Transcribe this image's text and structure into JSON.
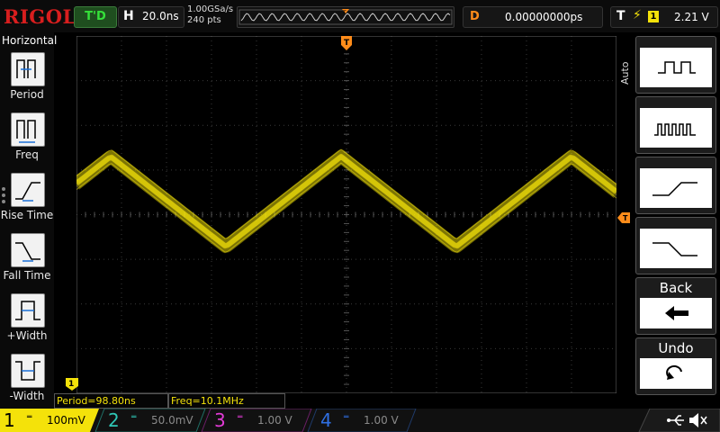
{
  "header": {
    "brand": "RIGOL",
    "run_state": "T'D",
    "horizontal": {
      "key": "H",
      "value": "20.0ns"
    },
    "sample_rate": "1.00GSa/s",
    "points": "240 pts",
    "delay": {
      "key": "D",
      "value": "0.00000000ps"
    },
    "trigger": {
      "key": "T",
      "source": "1",
      "level": "2.21 V"
    }
  },
  "left_menu": {
    "title": "Horizontal",
    "items": [
      {
        "label": "Period"
      },
      {
        "label": "Freq"
      },
      {
        "label": "Rise Time"
      },
      {
        "label": "Fall Time"
      },
      {
        "label": "+Width"
      },
      {
        "label": "-Width"
      }
    ]
  },
  "right_menu": {
    "mode_label": "Auto",
    "back_label": "Back",
    "undo_label": "Undo"
  },
  "measurements": [
    {
      "text": "Period=98.80ns"
    },
    {
      "text": "Freq=10.1MHz"
    }
  ],
  "channels": [
    {
      "num": "1",
      "value": "100mV",
      "color": "#f4e20a"
    },
    {
      "num": "2",
      "value": "50.0mV",
      "color": "#2fc7b6"
    },
    {
      "num": "3",
      "value": "1.00 V",
      "color": "#e23bd6"
    },
    {
      "num": "4",
      "value": "1.00 V",
      "color": "#2f6fe2"
    }
  ],
  "trace": {
    "color": "#f4e20a"
  }
}
